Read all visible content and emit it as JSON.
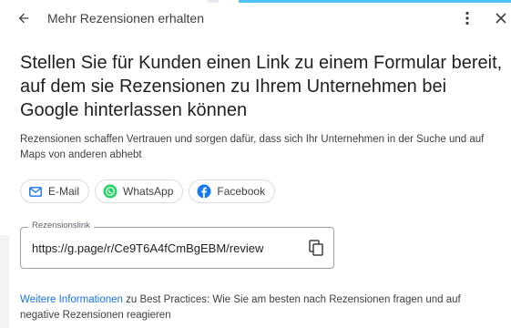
{
  "header": {
    "title": "Mehr Rezensionen erhalten",
    "back_icon": "arrow-back-icon",
    "more_icon": "more-vert-icon",
    "close_icon": "close-icon"
  },
  "main": {
    "headline": "Stellen Sie für Kunden einen Link zu einem Formular bereit, auf dem sie Rezensionen zu Ihrem Unternehmen bei Google hinterlassen können",
    "description": "Rezensionen schaffen Vertrauen und sorgen dafür, dass sich Ihr Unternehmen in der Suche und auf Maps von anderen abhebt",
    "share_buttons": [
      {
        "label": "E-Mail",
        "icon": "mail-icon",
        "color": "#1a73e8"
      },
      {
        "label": "WhatsApp",
        "icon": "whatsapp-icon",
        "color": "#25d366"
      },
      {
        "label": "Facebook",
        "icon": "facebook-icon",
        "color": "#1877f2"
      }
    ],
    "review_link": {
      "label": "Rezensionslink",
      "value": "https://g.page/r/Ce9T6A4fCmBgEBM/review",
      "copy_icon": "copy-icon"
    },
    "footer": {
      "link_text": "Weitere Informationen",
      "rest_text": " zu Best Practices: Wie Sie am besten nach Rezensionen fragen und auf negative Rezensionen reagieren",
      "link_color": "#1a73e8"
    }
  }
}
